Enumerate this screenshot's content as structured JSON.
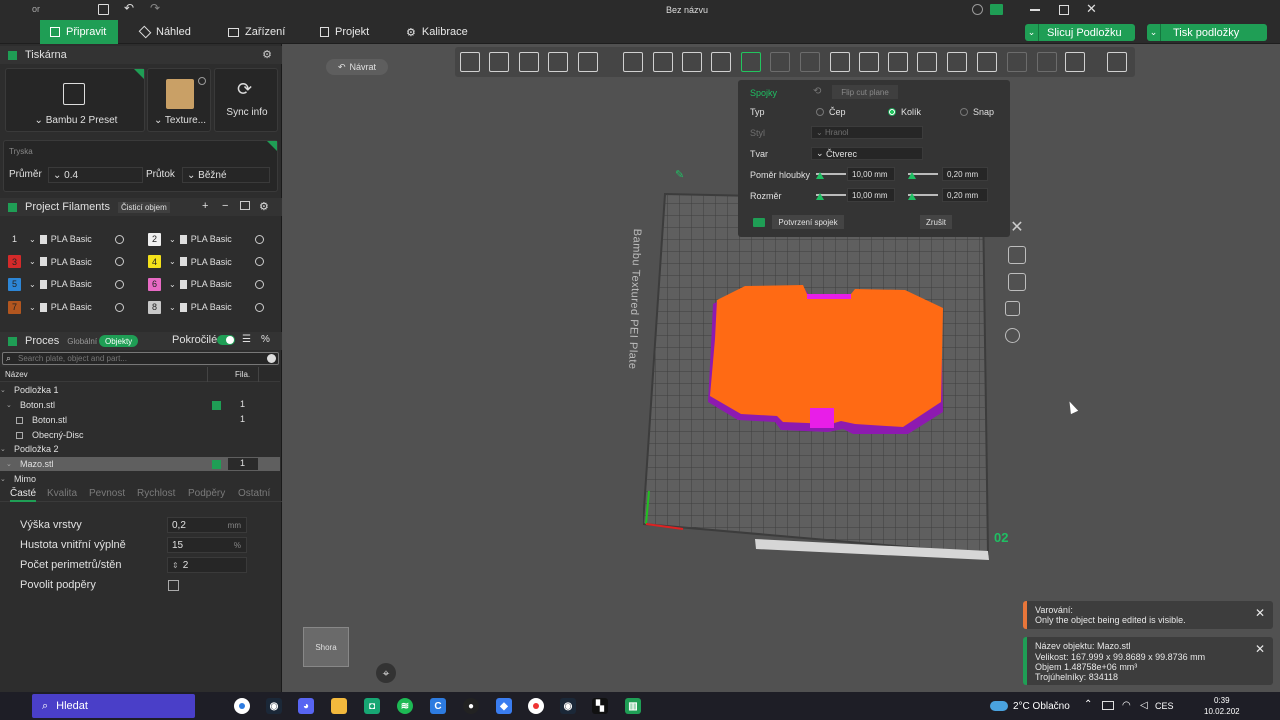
{
  "window": {
    "title": "Bez názvu",
    "app_label": "or"
  },
  "tabs": [
    {
      "label": "Připravit",
      "icon": "cube-icon"
    },
    {
      "label": "Náhled",
      "icon": "layers-icon"
    },
    {
      "label": "Zařízení",
      "icon": "device-icon"
    },
    {
      "label": "Projekt",
      "icon": "document-icon"
    },
    {
      "label": "Kalibrace",
      "icon": "gear-icon"
    }
  ],
  "actions": {
    "slice": "Slicuj Podložku",
    "print": "Tisk podložky"
  },
  "printer": {
    "section_title": "Tiskárna",
    "preset": "Bambu 2 Preset",
    "plate": "Texture...",
    "sync": "Sync info",
    "nozzle_section": "Tryska",
    "diameter_label": "Průměr",
    "diameter_value": "0.4",
    "flow_label": "Průtok",
    "flow_value": "Běžné"
  },
  "filaments": {
    "title": "Project Filaments",
    "badge": "Čisticí objem",
    "items": [
      {
        "num": "1",
        "name": "PLA Basic",
        "color": "#2d2d2d",
        "numcolor": "#e0e0e0"
      },
      {
        "num": "2",
        "name": "PLA Basic",
        "color": "#f0f0f0",
        "numcolor": "#222222"
      },
      {
        "num": "3",
        "name": "PLA Basic",
        "color": "#d42a2a",
        "numcolor": "#222222"
      },
      {
        "num": "4",
        "name": "PLA Basic",
        "color": "#f3e11a",
        "numcolor": "#222222"
      },
      {
        "num": "5",
        "name": "PLA Basic",
        "color": "#2d86d6",
        "numcolor": "#222222"
      },
      {
        "num": "6",
        "name": "PLA Basic",
        "color": "#e86ac4",
        "numcolor": "#222222"
      },
      {
        "num": "7",
        "name": "PLA Basic",
        "color": "#b2561f",
        "numcolor": "#222222"
      },
      {
        "num": "8",
        "name": "PLA Basic",
        "color": "#c8c8c8",
        "numcolor": "#222222"
      }
    ]
  },
  "process": {
    "title": "Proces",
    "global": "Globální",
    "objects": "Objekty",
    "advanced": "Pokročilé",
    "search_placeholder": "Search plate, object and part...",
    "col_name": "Název",
    "col_fila": "Fila.",
    "tree": [
      {
        "label": "Podložka 1",
        "fila": ""
      },
      {
        "label": "Boton.stl",
        "fila": "1"
      },
      {
        "label": "Boton.stl",
        "fila": "1"
      },
      {
        "label": "Obecný-Disc",
        "fila": ""
      },
      {
        "label": "Podložka 2",
        "fila": ""
      },
      {
        "label": "Mazo.stl",
        "fila": "1"
      },
      {
        "label": "Mimo",
        "fila": ""
      }
    ],
    "subtabs": [
      "Časté",
      "Kvalita",
      "Pevnost",
      "Rychlost",
      "Podpěry",
      "Ostatní"
    ],
    "settings": [
      {
        "label": "Výška vrstvy",
        "value": "0,2",
        "unit": "mm"
      },
      {
        "label": "Hustota vnitřní výplně",
        "value": "15",
        "unit": "%"
      },
      {
        "label": "Počet perimetrů/stěn",
        "value": "2",
        "unit": ""
      },
      {
        "label": "Povolit podpěry",
        "value": "",
        "unit": ""
      }
    ]
  },
  "viewport": {
    "back": "Návrat",
    "plate_name": "Bambu Textured PEI Plate",
    "plate_number": "02",
    "view_label": "Shora"
  },
  "cut_panel": {
    "header": "Spojky",
    "flip": "Flip cut plane",
    "type_label": "Typ",
    "type_options": [
      "Čep",
      "Kolík",
      "Snap"
    ],
    "type_selected": "Kolík",
    "style_label": "Styl",
    "style_value": "Hranol",
    "shape_label": "Tvar",
    "shape_value": "Čtverec",
    "depth_label": "Poměr hloubky",
    "depth_value": "10,00",
    "depth_tol": "0,20",
    "size_label": "Rozměr",
    "size_value": "10,00",
    "size_tol": "0,20",
    "unit": "mm",
    "confirm": "Potvrzení spojek",
    "cancel": "Zrušit"
  },
  "toasts": {
    "warning_title": "Varování:",
    "warning_text": "Only the object being edited is visible.",
    "info_name": "Název objektu: Mazo.stl",
    "info_size": "Velikost: 167.999 x 99.8689 x 99.8736 mm",
    "info_volume": "Objem 1.48758e+06 mm³",
    "info_triangles": "Trojúhelníky: 834118"
  },
  "taskbar": {
    "search": "Hledat",
    "weather": "2°C Oblačno",
    "lang": "CES",
    "time": "0:39",
    "date": "10.02.202"
  },
  "colors": {
    "accent": "#1f9e55",
    "model_orange": "#ff6a14",
    "connector_magenta": "#e81ee8"
  }
}
